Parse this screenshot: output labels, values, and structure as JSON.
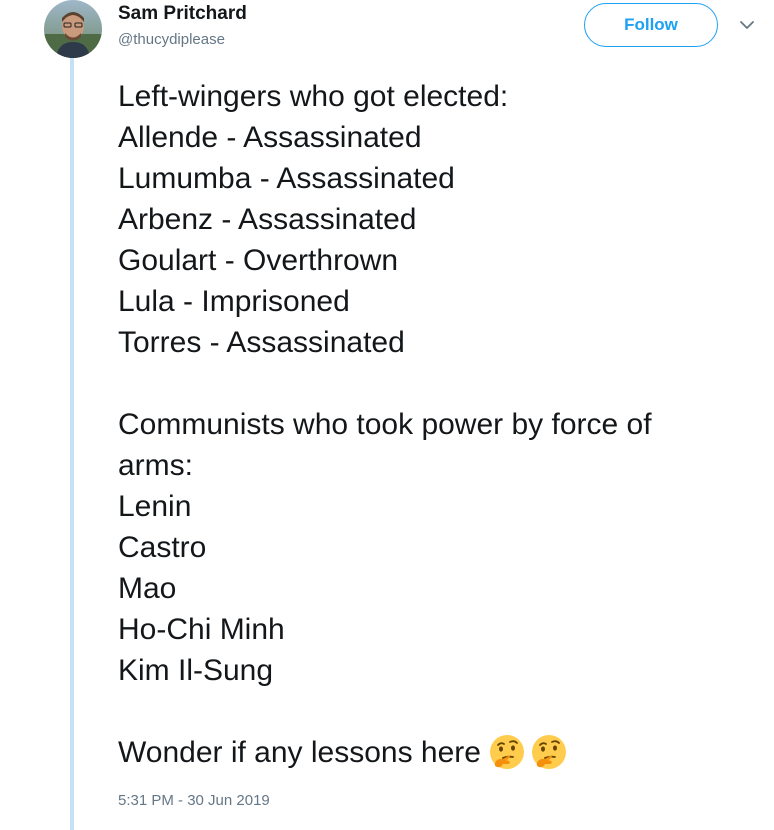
{
  "author": {
    "name": "Sam Pritchard",
    "handle": "@thucydiplease"
  },
  "follow_button": {
    "label": "Follow"
  },
  "menu": {
    "icon": "chevron-down-icon"
  },
  "tweet": {
    "intro": "Left-wingers who got elected:",
    "elected": [
      "Allende - Assassinated",
      "Lumumba - Assassinated",
      "Arbenz - Assassinated",
      "Goulart - Overthrown",
      "Lula - Imprisoned",
      "Torres - Assassinated"
    ],
    "communists_intro_1": "Communists who took power by force of",
    "communists_intro_2": "arms:",
    "communists": [
      "Lenin",
      "Castro",
      "Mao",
      "Ho-Chi Minh",
      "Kim Il-Sung"
    ],
    "closing": "Wonder if any lessons here",
    "emoji": [
      "thinking-face-icon",
      "thinking-face-icon"
    ]
  },
  "timestamp": "5:31 PM - 30 Jun 2019",
  "colors": {
    "accent": "#1da1f2",
    "thread_line": "#c4e1f5",
    "muted": "#657786"
  }
}
